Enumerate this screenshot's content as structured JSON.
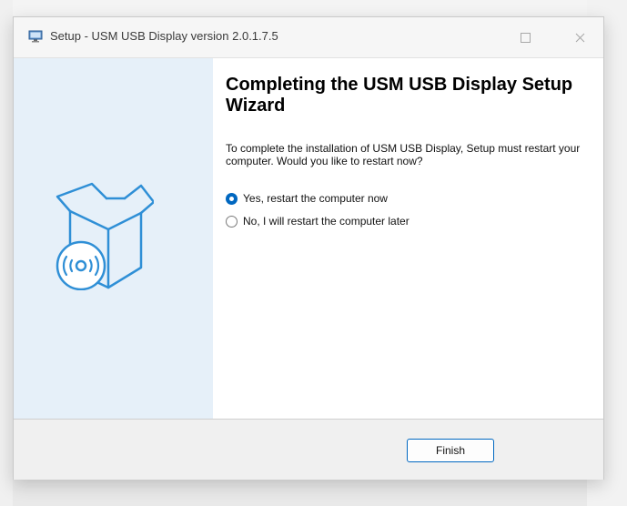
{
  "window": {
    "title": "Setup - USM USB Display version 2.0.1.7.5"
  },
  "wizard": {
    "heading": "Completing the USM USB Display Setup Wizard",
    "description": "To complete the installation of USM USB Display, Setup must restart your computer. Would you like to restart now?",
    "options": [
      {
        "label": "Yes, restart the computer now",
        "selected": true
      },
      {
        "label": "No, I will restart the computer later",
        "selected": false
      }
    ]
  },
  "footer": {
    "finish_label": "Finish"
  },
  "colors": {
    "accent": "#0067c0",
    "side_panel": "#e6f0f9",
    "illustration_stroke": "#2f8fd6"
  },
  "icons": {
    "app": "setup-monitor-icon",
    "illustration": "box-with-disc-icon",
    "maximize": "maximize-icon",
    "close": "close-icon"
  }
}
